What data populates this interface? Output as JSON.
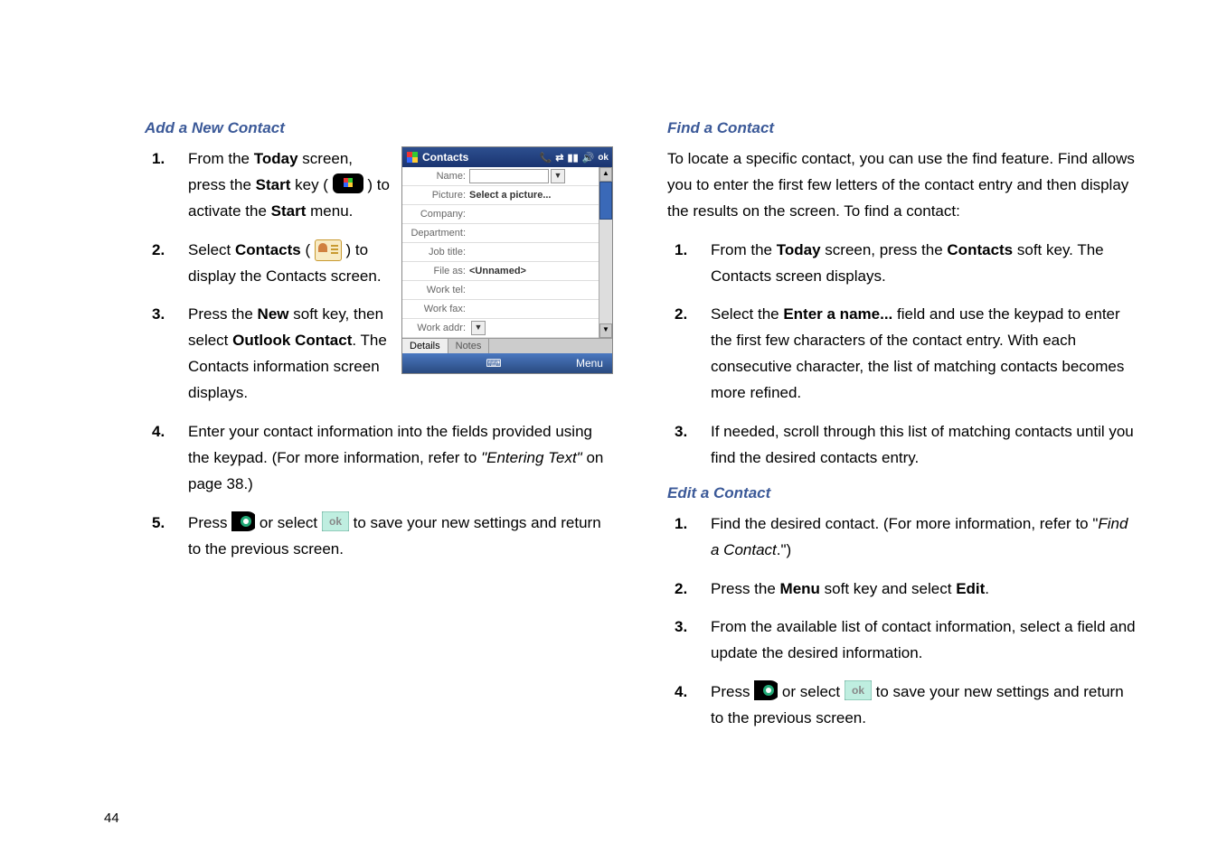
{
  "page_number": "44",
  "left": {
    "section_title": "Add a New Contact",
    "items": [
      {
        "num": "1.",
        "parts": [
          "From the ",
          {
            "b": "Today"
          },
          " screen, press the ",
          {
            "b": "Start"
          },
          " key ( ",
          " ) to activate the ",
          {
            "b": "Start"
          },
          " menu."
        ]
      },
      {
        "num": "2.",
        "parts": [
          "Select ",
          {
            "b": "Contacts"
          },
          " ( ",
          " ) to display the Contacts screen."
        ]
      },
      {
        "num": "3.",
        "parts": [
          "Press the ",
          {
            "b": "New"
          },
          " soft key, then select ",
          {
            "b": "Outlook Contact"
          },
          ". The Contacts information screen displays."
        ]
      },
      {
        "num": "4.",
        "parts": [
          "Enter your contact information into the fields provided using the keypad. (For more information, refer to ",
          {
            "i": "\"Entering Text\""
          },
          "  on page 38.)"
        ]
      },
      {
        "num": "5.",
        "parts": [
          "Press  ",
          " or select ",
          " to save your new settings and return to the previous screen."
        ]
      }
    ],
    "screenshot": {
      "title": "Contacts",
      "status_icons": [
        "phone",
        "sync",
        "signal",
        "volume",
        "ok"
      ],
      "fields": [
        {
          "label": "Name:",
          "value": "",
          "input": true,
          "dropdown": true
        },
        {
          "label": "Picture:",
          "value": "Select a picture..."
        },
        {
          "label": "Company:",
          "value": ""
        },
        {
          "label": "Department:",
          "value": ""
        },
        {
          "label": "Job title:",
          "value": ""
        },
        {
          "label": "File as:",
          "value": "<Unnamed>"
        },
        {
          "label": "Work tel:",
          "value": ""
        },
        {
          "label": "Work fax:",
          "value": ""
        },
        {
          "label": "Work addr:",
          "value": "",
          "dropdown": true
        }
      ],
      "tabs": [
        "Details",
        "Notes"
      ],
      "active_tab": 0,
      "softkeys": {
        "left": "",
        "center": "⌨",
        "right": "Menu"
      }
    }
  },
  "right": {
    "sections": [
      {
        "title": "Find a Contact",
        "intro": "To locate a specific contact, you can use the find feature. Find allows you to enter the first few letters of the contact entry and then display the results on the screen. To find a contact:",
        "items": [
          {
            "num": "1.",
            "parts": [
              "From the ",
              {
                "b": "Today"
              },
              " screen, press the ",
              {
                "b": "Contacts"
              },
              " soft key. The Contacts screen displays."
            ]
          },
          {
            "num": "2.",
            "parts": [
              "Select the ",
              {
                "b": "Enter a name..."
              },
              " field and use the keypad to enter the first few characters of the contact entry. With each consecutive character, the list of matching contacts becomes more refined."
            ]
          },
          {
            "num": "3.",
            "parts": [
              "If needed, scroll through this list of matching contacts until you find the desired contacts entry."
            ]
          }
        ]
      },
      {
        "title": "Edit a Contact",
        "items": [
          {
            "num": "1.",
            "parts": [
              "Find the desired contact. (For more information, refer to \"",
              {
                "i": "Find a Contact"
              },
              ".\")"
            ]
          },
          {
            "num": "2.",
            "parts": [
              "Press the ",
              {
                "b": "Menu"
              },
              " soft key and select ",
              {
                "b": "Edit"
              },
              "."
            ]
          },
          {
            "num": "3.",
            "parts": [
              "From the available list of contact information, select a field and update the desired information."
            ]
          },
          {
            "num": "4.",
            "parts": [
              "Press  ",
              " or select ",
              " to save your new settings and return to the previous screen."
            ]
          }
        ]
      }
    ]
  },
  "icons": {
    "start_key": "start-flag-icon",
    "contacts_icon": "contacts-card-icon",
    "action_button": "action-circle-icon",
    "ok_button": "ok-button-icon",
    "keyboard": "keyboard-icon"
  }
}
